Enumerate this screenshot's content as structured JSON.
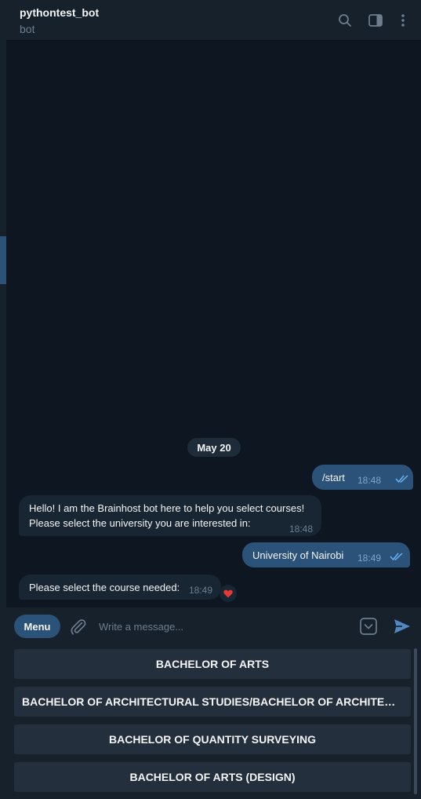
{
  "header": {
    "title": "pythontest_bot",
    "subtitle": "bot",
    "icons": [
      "search-icon",
      "sidebar-toggle-icon",
      "more-vertical-icon"
    ]
  },
  "chat": {
    "date": "May 20",
    "messages": [
      {
        "direction": "out",
        "text": "/start",
        "time": "18:48",
        "read": true
      },
      {
        "direction": "in",
        "lines": [
          "Hello! I am the Brainhost bot here to help you select courses!",
          "Please select the university you are interested in:"
        ],
        "time": "18:48"
      },
      {
        "direction": "out",
        "text": "University of Nairobi",
        "time": "18:49",
        "read": true
      },
      {
        "direction": "in",
        "text": "Please select the course needed:",
        "time": "18:49",
        "reaction": "heart"
      }
    ]
  },
  "composer": {
    "menu_label": "Menu",
    "placeholder": "Write a message..."
  },
  "keyboard": {
    "buttons": [
      "BACHELOR OF ARTS",
      "BACHELOR OF ARCHITECTURAL STUDIES/BACHELOR OF ARCHITECTURE",
      "BACHELOR OF QUANTITY SURVEYING",
      "BACHELOR OF ARTS (DESIGN)"
    ]
  },
  "colors": {
    "background": "#0e1621",
    "panel": "#17212b",
    "outgoing_bubble": "#2b5278",
    "incoming_bubble": "#182533",
    "accent": "#5288c1"
  }
}
